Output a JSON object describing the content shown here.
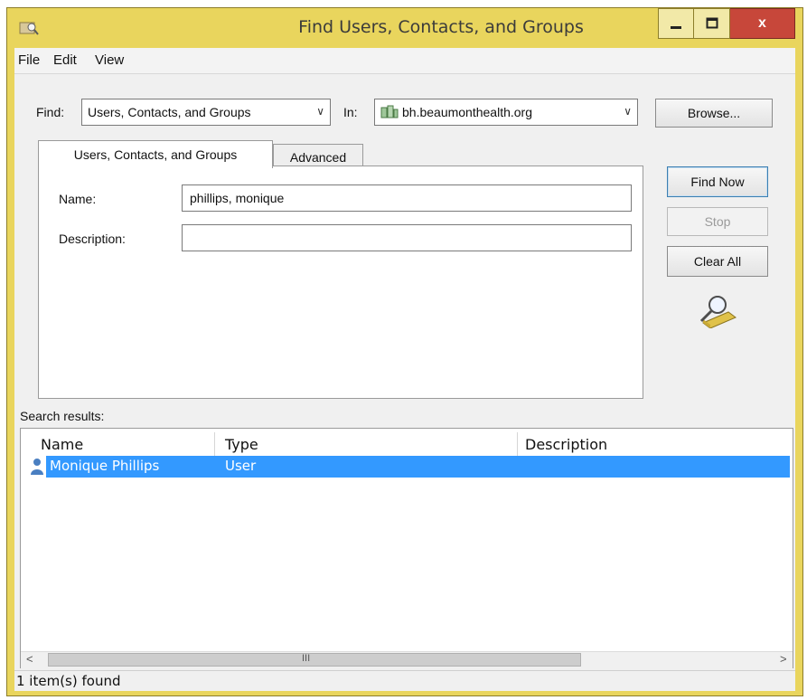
{
  "window": {
    "title": "Find Users, Contacts, and Groups",
    "close_glyph": "x",
    "accent_color": "#e9d55d",
    "close_color": "#c7473a"
  },
  "menu": {
    "items": [
      "File",
      "Edit",
      "View"
    ]
  },
  "find": {
    "label": "Find:",
    "value": "Users, Contacts, and Groups",
    "in_label": "In:",
    "in_value": "bh.beaumonthealth.org",
    "browse_label": "Browse..."
  },
  "tabs": [
    {
      "label": "Users, Contacts, and Groups",
      "active": true
    },
    {
      "label": "Advanced",
      "active": false
    }
  ],
  "form": {
    "name_label": "Name:",
    "name_value": "phillips, monique",
    "description_label": "Description:",
    "description_value": ""
  },
  "actions": {
    "find_now": "Find Now",
    "stop": "Stop",
    "clear_all": "Clear All"
  },
  "results": {
    "label": "Search results:",
    "columns": [
      "Name",
      "Type",
      "Description"
    ],
    "rows": [
      {
        "name": "Monique Phillips",
        "type": "User",
        "description": "",
        "selected": true
      }
    ],
    "selection_color": "#3399ff",
    "scroll_left": "<",
    "scroll_thumb": "III",
    "scroll_right": ">"
  },
  "status": {
    "text": "1 item(s) found"
  },
  "icons": [
    "app-icon",
    "minimize-icon",
    "maximize-icon",
    "close-icon",
    "domain-icon",
    "chevron-down-icon",
    "magnifier-icon",
    "user-icon"
  ]
}
